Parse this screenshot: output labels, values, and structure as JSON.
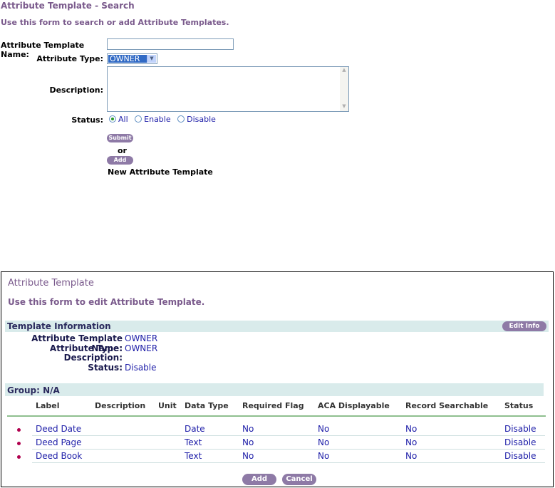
{
  "search": {
    "title": "Attribute Template - Search",
    "subtitle": "Use this form to search or add Attribute Templates.",
    "name_label": "Attribute Template Name:",
    "name_value": "",
    "type_label": "Attribute Type:",
    "type_value": "OWNER",
    "description_label": "Description:",
    "status_label": "Status:",
    "status_options": [
      "All",
      "Enable",
      "Disable"
    ],
    "status_selected": "All",
    "submit_label": "Submit",
    "or_text": "or",
    "add_label": "Add",
    "new_template_text": "New Attribute Template"
  },
  "edit": {
    "title": "Attribute Template",
    "subtitle": "Use this form to edit Attribute Template.",
    "section_title": "Template Information",
    "edit_info_label": "Edit Info",
    "fields": {
      "name_label": "Attribute Template Name:",
      "name_value": "OWNER",
      "type_label": "Attribute Type:",
      "type_value": "OWNER",
      "description_label": "Description:",
      "description_value": "",
      "status_label": "Status:",
      "status_value": "Disable"
    },
    "group_title": "Group: N/A",
    "columns": [
      "Label",
      "Description",
      "Unit",
      "Data Type",
      "Required Flag",
      "ACA Displayable",
      "Record Searchable",
      "Status"
    ],
    "rows": [
      {
        "label": "Deed Date",
        "description": "",
        "unit": "",
        "data_type": "Date",
        "required": "No",
        "aca": "No",
        "searchable": "No",
        "status": "Disable"
      },
      {
        "label": "Deed Page",
        "description": "",
        "unit": "",
        "data_type": "Text",
        "required": "No",
        "aca": "No",
        "searchable": "No",
        "status": "Disable"
      },
      {
        "label": "Deed Book",
        "description": "",
        "unit": "",
        "data_type": "Text",
        "required": "No",
        "aca": "No",
        "searchable": "No",
        "status": "Disable"
      }
    ],
    "add_label": "Add",
    "cancel_label": "Cancel"
  },
  "colors": {
    "heading_purple": "#7a5a8c",
    "link_blue": "#1d1da8",
    "button_purple": "#8e7aa6",
    "section_bar": "#d9ebeb",
    "bullet": "#b0004e"
  }
}
